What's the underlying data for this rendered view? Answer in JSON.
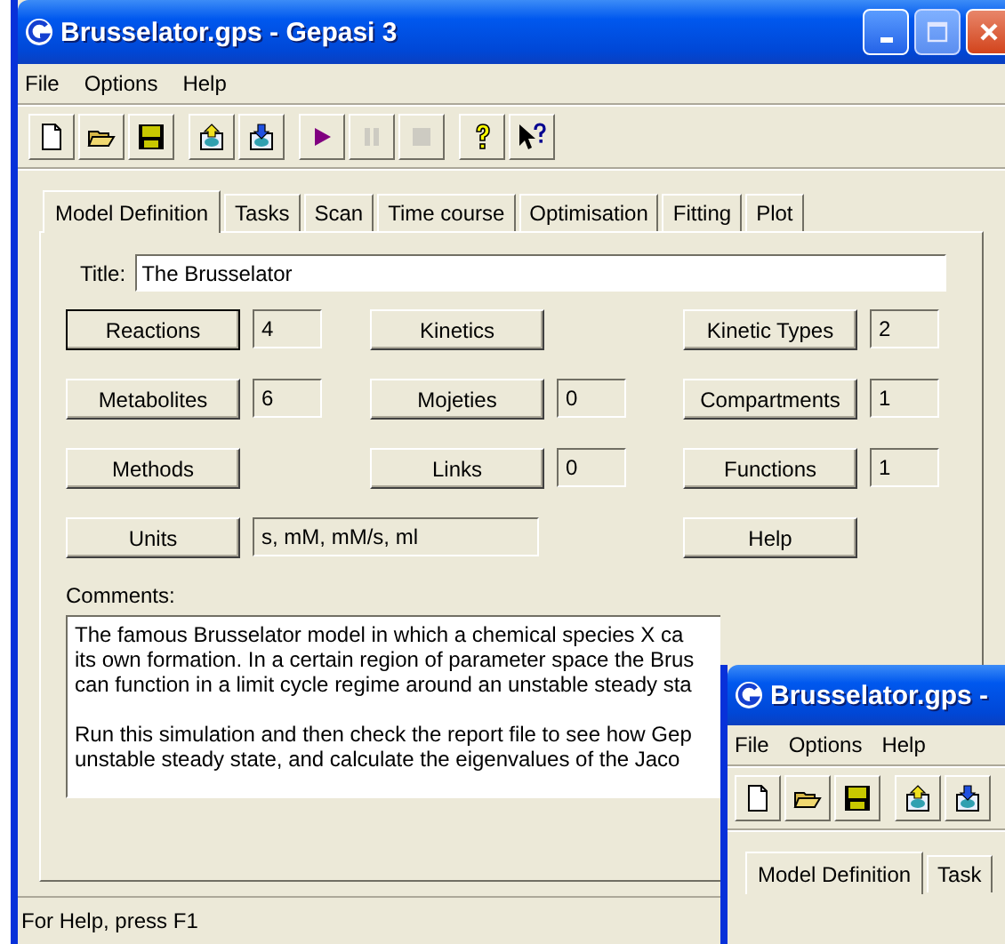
{
  "window": {
    "title": "Brusselator.gps - Gepasi 3"
  },
  "menu": [
    "File",
    "Options",
    "Help"
  ],
  "toolbar": [
    [
      {
        "kind": "new",
        "disabled": false
      },
      {
        "kind": "open",
        "disabled": false
      },
      {
        "kind": "save",
        "disabled": false
      }
    ],
    [
      {
        "kind": "import",
        "disabled": false
      },
      {
        "kind": "export",
        "disabled": false
      }
    ],
    [
      {
        "kind": "run",
        "disabled": false
      },
      {
        "kind": "pause",
        "disabled": true
      },
      {
        "kind": "stop",
        "disabled": true
      }
    ],
    [
      {
        "kind": "help",
        "disabled": false
      },
      {
        "kind": "context-help",
        "disabled": false
      }
    ]
  ],
  "tabs": [
    {
      "label": "Model Definition",
      "selected": true
    },
    {
      "label": "Tasks",
      "selected": false
    },
    {
      "label": "Scan",
      "selected": false
    },
    {
      "label": "Time course",
      "selected": false
    },
    {
      "label": "Optimisation",
      "selected": false
    },
    {
      "label": "Fitting",
      "selected": false
    },
    {
      "label": "Plot",
      "selected": false
    }
  ],
  "title_field": {
    "label": "Title:",
    "value": "The Brusselator"
  },
  "rows": [
    [
      {
        "kind": "pair",
        "label": "Reactions",
        "value": "4",
        "default": true
      },
      {
        "kind": "button",
        "label": "Kinetics",
        "default": false
      },
      {
        "kind": "pair",
        "label": "Kinetic Types",
        "value": "2",
        "default": false
      }
    ],
    [
      {
        "kind": "pair",
        "label": "Metabolites",
        "value": "6",
        "default": false
      },
      {
        "kind": "pair",
        "label": "Mojeties",
        "value": "0",
        "default": false
      },
      {
        "kind": "pair",
        "label": "Compartments",
        "value": "1",
        "default": false
      }
    ],
    [
      {
        "kind": "button",
        "label": "Methods",
        "default": false
      },
      {
        "kind": "pair",
        "label": "Links",
        "value": "0",
        "default": false
      },
      {
        "kind": "pair",
        "label": "Functions",
        "value": "1",
        "default": false
      }
    ],
    [
      {
        "kind": "wide",
        "label": "Units",
        "value": "s, mM, mM/s, ml",
        "default": false
      },
      {
        "kind": "button",
        "label": "Help",
        "default": false
      }
    ]
  ],
  "comments": {
    "label": "Comments:",
    "paragraphs": [
      "The famous Brusselator model in which a chemical species X ca\nits own formation. In a certain region of parameter space the Brus\ncan function in a limit cycle regime around an unstable steady sta",
      "Run this simulation and then check the report file to see how Gep\nunstable steady state, and calculate the eigenvalues of the Jaco"
    ]
  },
  "status_bar": "For Help, press F1",
  "second_window": {
    "title": "Brusselator.gps -",
    "menu": [
      "File",
      "Options",
      "Help"
    ],
    "toolbar": [
      [
        {
          "kind": "new",
          "disabled": false
        },
        {
          "kind": "open",
          "disabled": false
        },
        {
          "kind": "save",
          "disabled": false
        }
      ],
      [
        {
          "kind": "import",
          "disabled": false
        },
        {
          "kind": "export",
          "disabled": false
        }
      ]
    ],
    "tabs": [
      {
        "label": "Model Definition",
        "selected": true
      },
      {
        "label": "Task",
        "selected": false
      }
    ]
  }
}
